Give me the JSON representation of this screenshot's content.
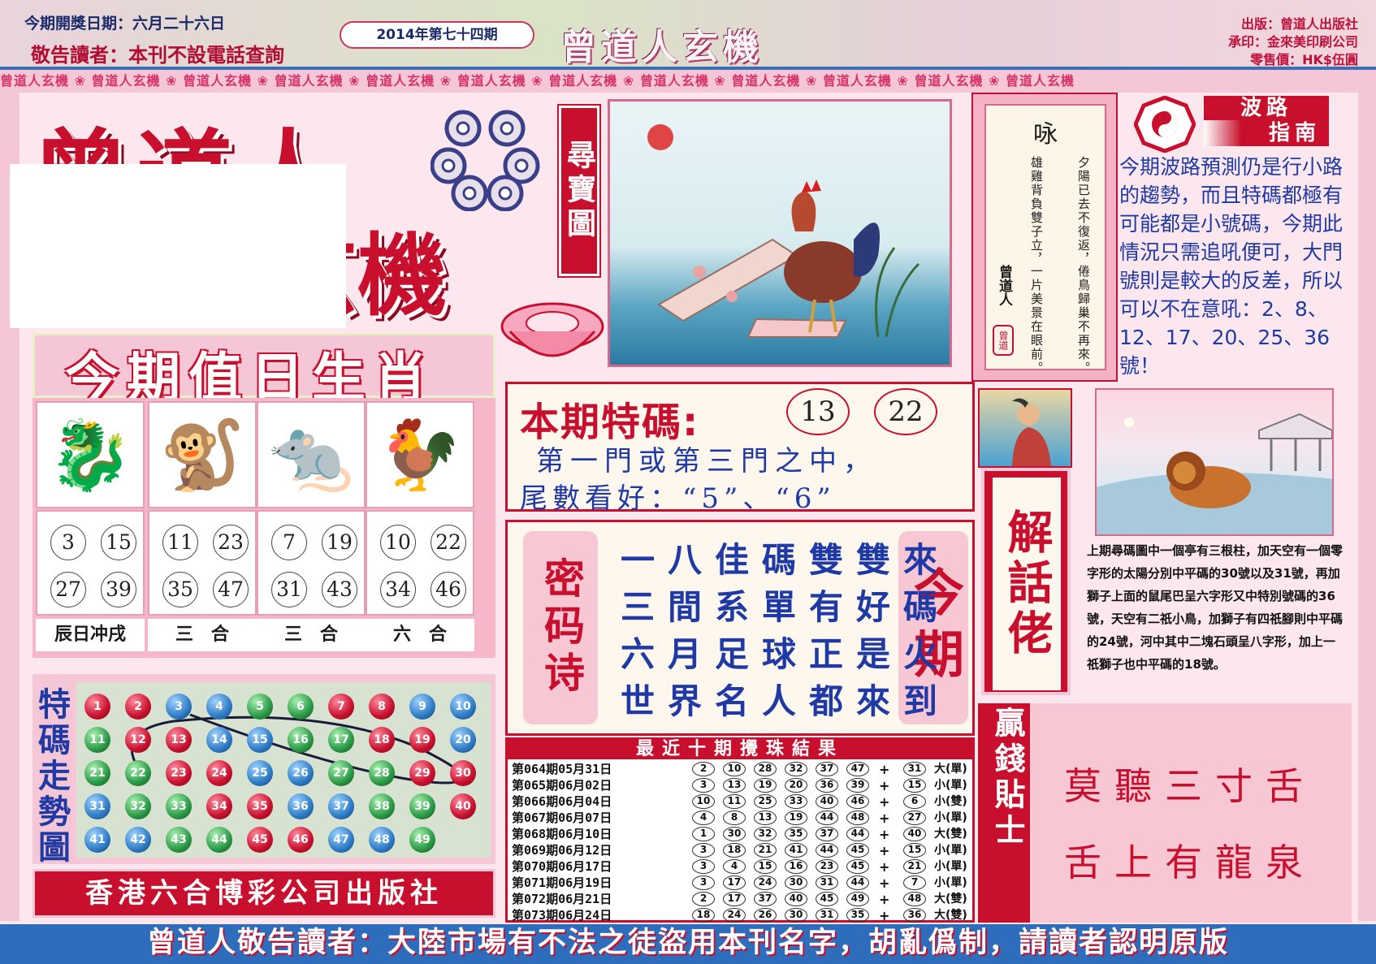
{
  "header": {
    "draw_date": "今期開獎日期：六月二十六日",
    "notice": "敬告讀者：本刊不設電話查詢",
    "issue": "2014年第七十四期",
    "brand": "曾道人玄機",
    "publisher": "出版：曾道人出版社",
    "printer": "承印：金來美印刷公司",
    "price": "零售價：HK$伍圓"
  },
  "strip_text": "曾道人玄機 ❀ 曾道人玄機 ❀ 曾道人玄機 ❀ 曾道人玄機 ❀ 曾道人玄機 ❀ 曾道人玄機 ❀ 曾道人玄機 ❀ 曾道人玄機 ❀ 曾道人玄機 ❀ 曾道人玄機 ❀ 曾道人玄機 ❀ 曾道人玄機",
  "logo": {
    "line1": "曾道人",
    "line2": "玄機"
  },
  "treasure_map": {
    "label": "尋寶圖",
    "icon": "rooster-picture"
  },
  "poem": {
    "title": "咏",
    "columns": [
      "夕陽已去不復返，",
      "倦鳥歸巢不再來。",
      "雄雞背負雙子立，",
      "一片美景在眼前。"
    ],
    "signature": "曾道人",
    "seal": "曾道"
  },
  "wave_guide": {
    "title_1": "波路",
    "title_2": "指南",
    "text": "今期波路預測仍是行小路的趨勢，而且特碼都極有可能都是小號碼，今期此情況只需追吼便可，大門號則是較大的反差，所以可以不在意吼：2、8、12、17、20、25、36號！"
  },
  "zodiac": {
    "title": "今期值日生肖",
    "animals": [
      {
        "icon": "dragon-icon",
        "glyph": "🐉",
        "nums": [
          "3",
          "15",
          "27",
          "39"
        ],
        "label": "辰日冲戌"
      },
      {
        "icon": "monkey-icon",
        "glyph": "🐒",
        "nums": [
          "11",
          "23",
          "35",
          "47"
        ],
        "label": "三　合"
      },
      {
        "icon": "rat-icon",
        "glyph": "🐀",
        "nums": [
          "7",
          "19",
          "31",
          "43"
        ],
        "label": "三　合"
      },
      {
        "icon": "rooster-icon",
        "glyph": "🐓",
        "nums": [
          "10",
          "22",
          "34",
          "46"
        ],
        "label": "六　合"
      }
    ]
  },
  "trend": {
    "label": "特碼走勢圖",
    "balls": [
      {
        "n": "1",
        "c": "red"
      },
      {
        "n": "2",
        "c": "red"
      },
      {
        "n": "3",
        "c": "blue"
      },
      {
        "n": "4",
        "c": "blue"
      },
      {
        "n": "5",
        "c": "green"
      },
      {
        "n": "6",
        "c": "green"
      },
      {
        "n": "7",
        "c": "red"
      },
      {
        "n": "8",
        "c": "red"
      },
      {
        "n": "9",
        "c": "blue"
      },
      {
        "n": "10",
        "c": "blue"
      },
      {
        "n": "11",
        "c": "green"
      },
      {
        "n": "12",
        "c": "red"
      },
      {
        "n": "13",
        "c": "red"
      },
      {
        "n": "14",
        "c": "blue"
      },
      {
        "n": "15",
        "c": "blue"
      },
      {
        "n": "16",
        "c": "green"
      },
      {
        "n": "17",
        "c": "green"
      },
      {
        "n": "18",
        "c": "red"
      },
      {
        "n": "19",
        "c": "red"
      },
      {
        "n": "20",
        "c": "blue"
      },
      {
        "n": "21",
        "c": "green"
      },
      {
        "n": "22",
        "c": "green"
      },
      {
        "n": "23",
        "c": "red"
      },
      {
        "n": "24",
        "c": "red"
      },
      {
        "n": "25",
        "c": "blue"
      },
      {
        "n": "26",
        "c": "blue"
      },
      {
        "n": "27",
        "c": "green"
      },
      {
        "n": "28",
        "c": "green"
      },
      {
        "n": "29",
        "c": "red"
      },
      {
        "n": "30",
        "c": "red"
      },
      {
        "n": "31",
        "c": "blue"
      },
      {
        "n": "32",
        "c": "green"
      },
      {
        "n": "33",
        "c": "green"
      },
      {
        "n": "34",
        "c": "red"
      },
      {
        "n": "35",
        "c": "red"
      },
      {
        "n": "36",
        "c": "blue"
      },
      {
        "n": "37",
        "c": "blue"
      },
      {
        "n": "38",
        "c": "green"
      },
      {
        "n": "39",
        "c": "green"
      },
      {
        "n": "40",
        "c": "red"
      },
      {
        "n": "41",
        "c": "blue"
      },
      {
        "n": "42",
        "c": "blue"
      },
      {
        "n": "43",
        "c": "green"
      },
      {
        "n": "44",
        "c": "green"
      },
      {
        "n": "45",
        "c": "red"
      },
      {
        "n": "46",
        "c": "red"
      },
      {
        "n": "47",
        "c": "blue"
      },
      {
        "n": "48",
        "c": "blue"
      },
      {
        "n": "49",
        "c": "green"
      }
    ]
  },
  "publisher_bar": "香港六合博彩公司出版社",
  "special": {
    "label": "本期特碼:",
    "codes": [
      "13",
      "22"
    ],
    "line1": "第一門或第三門之中，",
    "line2": "尾數看好：“5”、“6”"
  },
  "cipher": {
    "left": "密码诗",
    "right": "今期",
    "lines": [
      "一八佳碼雙雙來",
      "三間系單有好碼",
      "六月足球正是火",
      "世界名人都來到"
    ]
  },
  "results": {
    "title": "最近十期攪珠結果",
    "rows": [
      {
        "period": "第064期05月31日",
        "nums": [
          "2",
          "10",
          "28",
          "32",
          "37",
          "47"
        ],
        "special": "31",
        "tag": "大(單)"
      },
      {
        "period": "第065期06月02日",
        "nums": [
          "3",
          "13",
          "19",
          "20",
          "36",
          "39"
        ],
        "special": "15",
        "tag": "小(單)"
      },
      {
        "period": "第066期06月04日",
        "nums": [
          "10",
          "11",
          "25",
          "33",
          "40",
          "46"
        ],
        "special": "6",
        "tag": "小(雙)"
      },
      {
        "period": "第067期06月07日",
        "nums": [
          "4",
          "8",
          "13",
          "19",
          "44",
          "48"
        ],
        "special": "27",
        "tag": "小(單)"
      },
      {
        "period": "第068期06月10日",
        "nums": [
          "1",
          "30",
          "32",
          "35",
          "37",
          "44"
        ],
        "special": "40",
        "tag": "大(雙)"
      },
      {
        "period": "第069期06月12日",
        "nums": [
          "3",
          "18",
          "21",
          "41",
          "44",
          "45"
        ],
        "special": "15",
        "tag": "小(單)"
      },
      {
        "period": "第070期06月17日",
        "nums": [
          "3",
          "4",
          "15",
          "16",
          "23",
          "45"
        ],
        "special": "21",
        "tag": "小(單)"
      },
      {
        "period": "第071期06月19日",
        "nums": [
          "3",
          "17",
          "24",
          "30",
          "31",
          "44"
        ],
        "special": "7",
        "tag": "小(單)"
      },
      {
        "period": "第072期06月21日",
        "nums": [
          "2",
          "17",
          "37",
          "40",
          "45",
          "49"
        ],
        "special": "48",
        "tag": "大(雙)"
      },
      {
        "period": "第073期06月24日",
        "nums": [
          "18",
          "24",
          "26",
          "30",
          "31",
          "35"
        ],
        "special": "36",
        "tag": "大(雙)"
      }
    ]
  },
  "explainer": {
    "title": "解話佬",
    "text": "上期尋碼圖中一個亭有三根柱，加天空有一個零字形的太陽分別中平碼的30號以及31號，再加獅子上面的鼠尾巴呈六字形又中特別號碼的36號，天空有二祇小鳥，加獅子有四祇腳則中平碼的24號，河中其中二塊石頭呈八字形，加上一祇獅子也中平碼的18號。"
  },
  "win_tip": {
    "label": "贏錢貼士",
    "lines": [
      "莫聽三寸舌",
      "舌上有龍泉"
    ]
  },
  "footer": "曾道人敬告讀者：大陸市場有不法之徒盜用本刊名字，胡亂僞制，請讀者認明原版"
}
